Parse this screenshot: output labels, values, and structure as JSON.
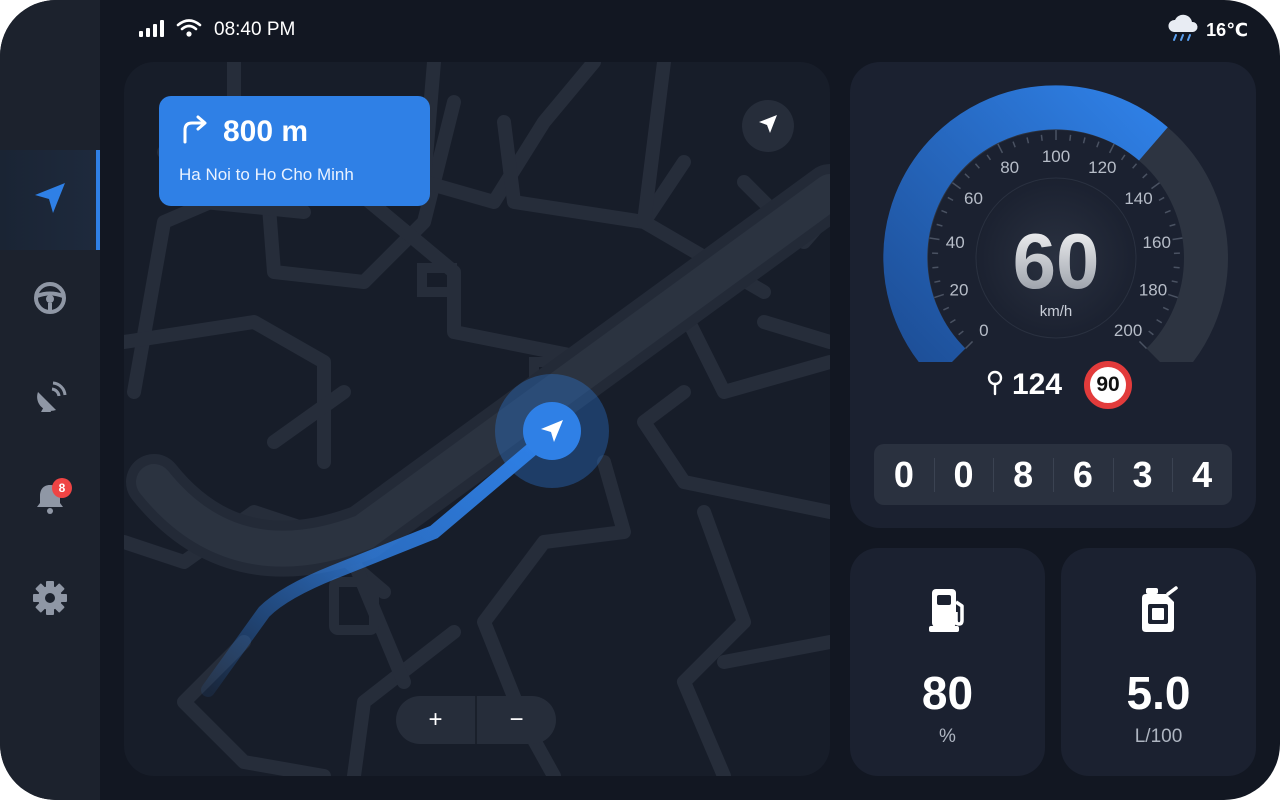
{
  "status_bar": {
    "time": "08:40 PM",
    "signal_icon": "signal-bars-icon",
    "wifi_icon": "wifi-icon",
    "weather_icon": "rain-cloud-icon",
    "temperature": "16℃"
  },
  "sidebar": {
    "items": [
      {
        "name": "navigation",
        "icon": "navigation-arrow-icon",
        "active": true
      },
      {
        "name": "steering",
        "icon": "steering-wheel-icon",
        "active": false
      },
      {
        "name": "satellite",
        "icon": "satellite-dish-icon",
        "active": false
      },
      {
        "name": "notifications",
        "icon": "bell-icon",
        "active": false,
        "badge": "8"
      },
      {
        "name": "settings",
        "icon": "gear-icon",
        "active": false
      }
    ]
  },
  "navigation": {
    "turn_icon": "turn-right-icon",
    "distance": "800 m",
    "route": "Ha Noi to Ho Cho Minh"
  },
  "map_controls": {
    "zoom_in": "+",
    "zoom_out": "−"
  },
  "speedometer": {
    "speed": "60",
    "unit": "km/h",
    "ticks": [
      "0",
      "20",
      "40",
      "60",
      "80",
      "100",
      "120",
      "140",
      "160",
      "180",
      "200"
    ],
    "max_speed": 200,
    "highlight_value": 130,
    "accent_color": "#2f80e6"
  },
  "trip": {
    "pin_icon": "location-pin-icon",
    "distance": "124",
    "speed_limit": "90"
  },
  "odometer": {
    "digits": [
      "0",
      "0",
      "8",
      "6",
      "3",
      "4"
    ]
  },
  "fuel": {
    "icon": "fuel-pump-icon",
    "value": "80",
    "unit": "%"
  },
  "consumption": {
    "icon": "fuel-can-icon",
    "value": "5.0",
    "unit": "L/100"
  }
}
